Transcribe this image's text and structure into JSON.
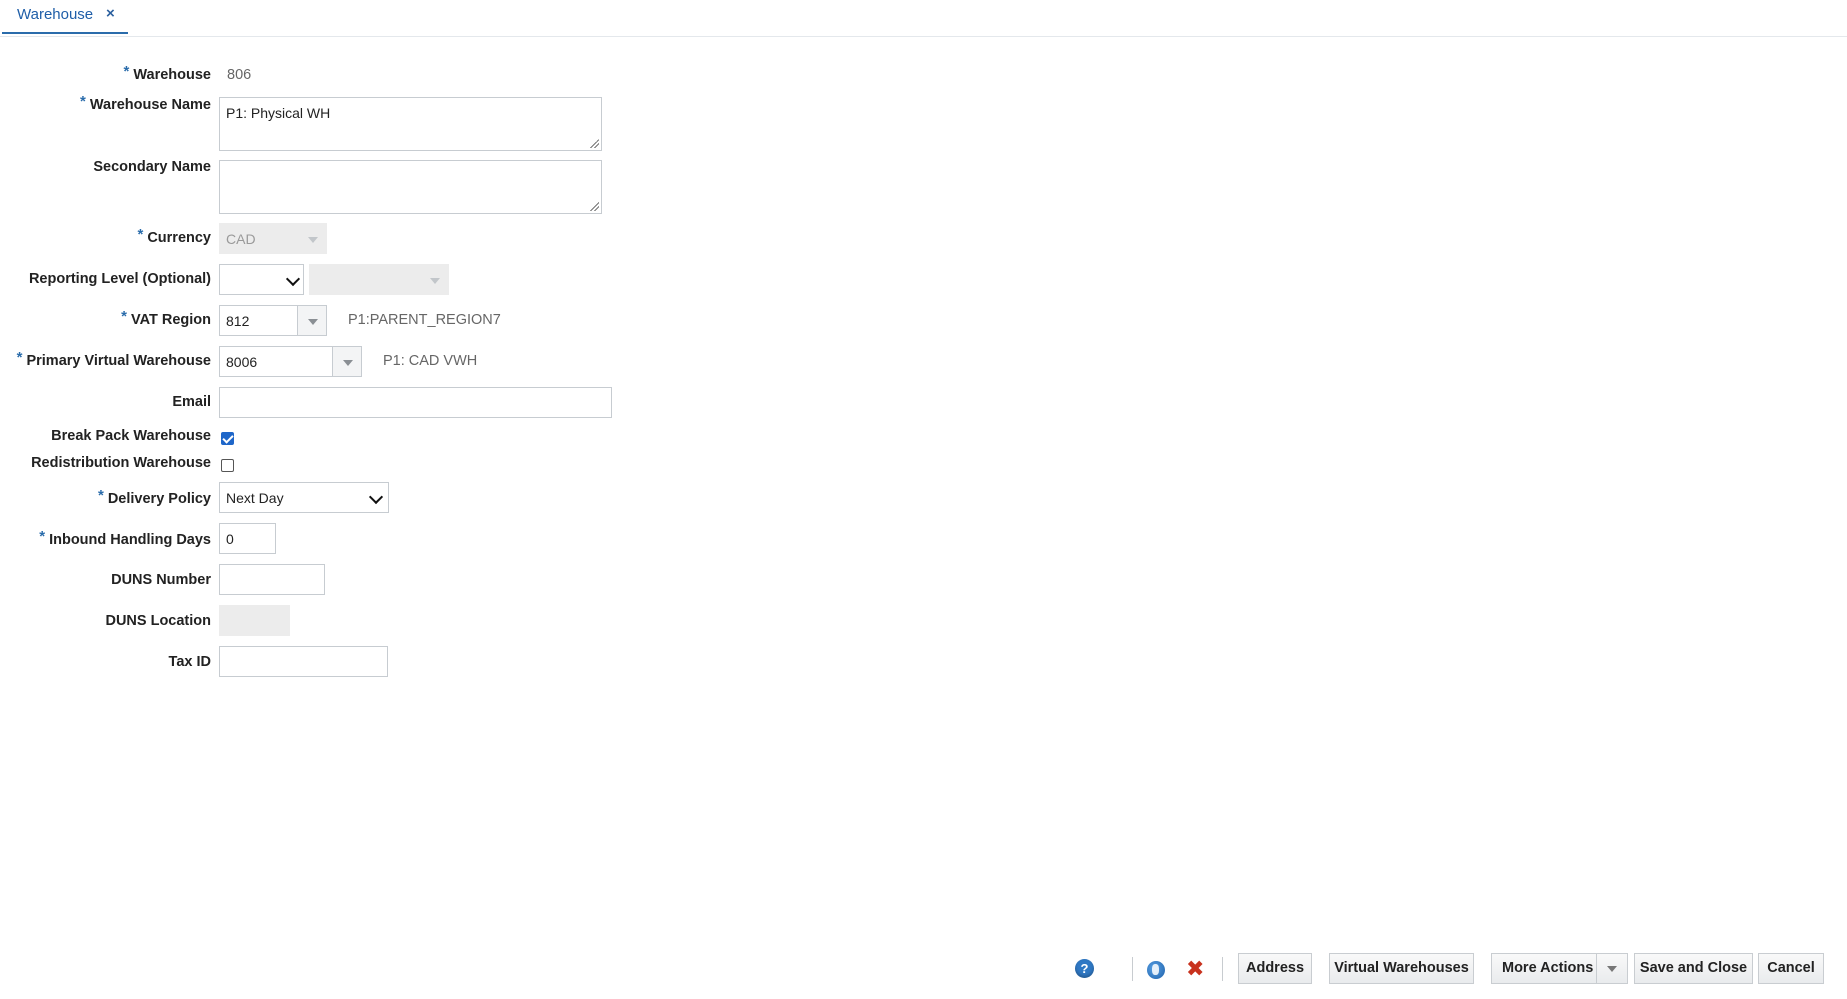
{
  "tab": {
    "label": "Warehouse",
    "close": "×"
  },
  "form": {
    "warehouse": {
      "label": "Warehouse",
      "value": "806"
    },
    "warehouse_name": {
      "label": "Warehouse Name",
      "value": "P1: Physical WH"
    },
    "secondary_name": {
      "label": "Secondary Name",
      "value": ""
    },
    "currency": {
      "label": "Currency",
      "value": "CAD"
    },
    "reporting_level": {
      "label": "Reporting Level (Optional)",
      "value": "",
      "value2": ""
    },
    "vat_region": {
      "label": "VAT Region",
      "value": "812",
      "description": "P1:PARENT_REGION7"
    },
    "primary_virtual_warehouse": {
      "label": "Primary Virtual Warehouse",
      "value": "8006",
      "description": "P1: CAD VWH"
    },
    "email": {
      "label": "Email",
      "value": ""
    },
    "break_pack_warehouse": {
      "label": "Break Pack Warehouse",
      "checked": true
    },
    "redistribution_warehouse": {
      "label": "Redistribution Warehouse",
      "checked": false
    },
    "delivery_policy": {
      "label": "Delivery Policy",
      "value": "Next Day"
    },
    "inbound_handling_days": {
      "label": "Inbound Handling Days",
      "value": "0"
    },
    "duns_number": {
      "label": "DUNS Number",
      "value": ""
    },
    "duns_location": {
      "label": "DUNS Location",
      "value": ""
    },
    "tax_id": {
      "label": "Tax ID",
      "value": ""
    },
    "required_marker": "*"
  },
  "footer": {
    "help_icon": "help-icon",
    "help_glyph": "?",
    "globe_icon": "globe-icon",
    "delete_icon": "close-x-icon",
    "delete_glyph": "✖",
    "buttons": {
      "address": "Address",
      "virtual_warehouses": "Virtual Warehouses",
      "more_actions": "More Actions",
      "save_and_close": "Save and Close",
      "cancel": "Cancel"
    }
  },
  "colors": {
    "accent": "#2a6cab",
    "checkbox": "#1e66c9",
    "delete": "#c8321e"
  }
}
